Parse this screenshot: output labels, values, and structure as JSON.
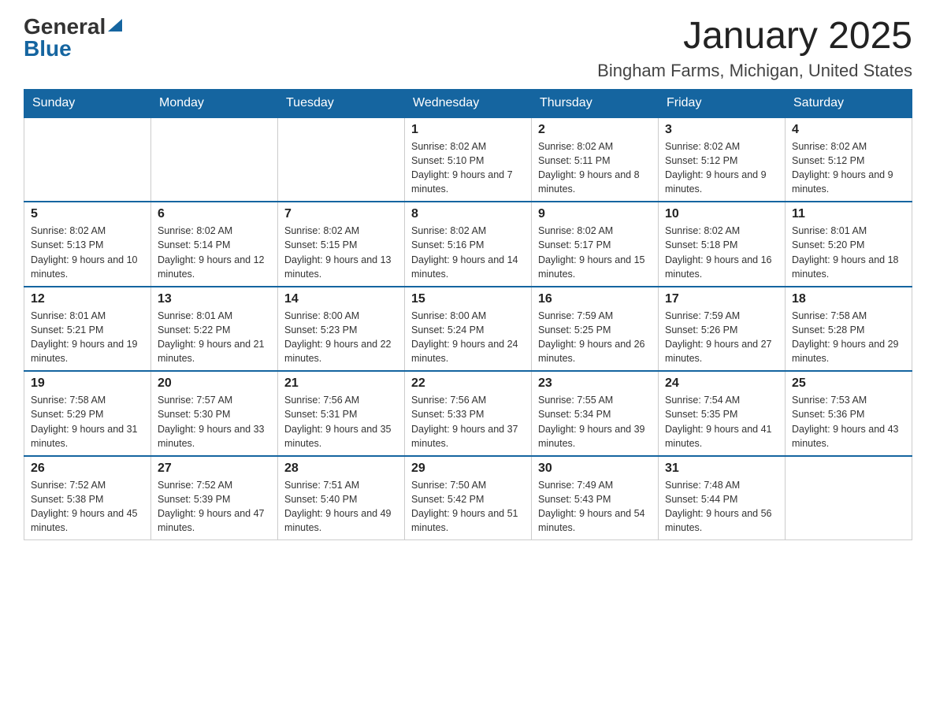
{
  "header": {
    "logo": {
      "general": "General",
      "blue": "Blue"
    },
    "title": "January 2025",
    "location": "Bingham Farms, Michigan, United States"
  },
  "days_of_week": [
    "Sunday",
    "Monday",
    "Tuesday",
    "Wednesday",
    "Thursday",
    "Friday",
    "Saturday"
  ],
  "weeks": [
    [
      {
        "day": "",
        "info": ""
      },
      {
        "day": "",
        "info": ""
      },
      {
        "day": "",
        "info": ""
      },
      {
        "day": "1",
        "info": "Sunrise: 8:02 AM\nSunset: 5:10 PM\nDaylight: 9 hours and 7 minutes."
      },
      {
        "day": "2",
        "info": "Sunrise: 8:02 AM\nSunset: 5:11 PM\nDaylight: 9 hours and 8 minutes."
      },
      {
        "day": "3",
        "info": "Sunrise: 8:02 AM\nSunset: 5:12 PM\nDaylight: 9 hours and 9 minutes."
      },
      {
        "day": "4",
        "info": "Sunrise: 8:02 AM\nSunset: 5:12 PM\nDaylight: 9 hours and 9 minutes."
      }
    ],
    [
      {
        "day": "5",
        "info": "Sunrise: 8:02 AM\nSunset: 5:13 PM\nDaylight: 9 hours and 10 minutes."
      },
      {
        "day": "6",
        "info": "Sunrise: 8:02 AM\nSunset: 5:14 PM\nDaylight: 9 hours and 12 minutes."
      },
      {
        "day": "7",
        "info": "Sunrise: 8:02 AM\nSunset: 5:15 PM\nDaylight: 9 hours and 13 minutes."
      },
      {
        "day": "8",
        "info": "Sunrise: 8:02 AM\nSunset: 5:16 PM\nDaylight: 9 hours and 14 minutes."
      },
      {
        "day": "9",
        "info": "Sunrise: 8:02 AM\nSunset: 5:17 PM\nDaylight: 9 hours and 15 minutes."
      },
      {
        "day": "10",
        "info": "Sunrise: 8:02 AM\nSunset: 5:18 PM\nDaylight: 9 hours and 16 minutes."
      },
      {
        "day": "11",
        "info": "Sunrise: 8:01 AM\nSunset: 5:20 PM\nDaylight: 9 hours and 18 minutes."
      }
    ],
    [
      {
        "day": "12",
        "info": "Sunrise: 8:01 AM\nSunset: 5:21 PM\nDaylight: 9 hours and 19 minutes."
      },
      {
        "day": "13",
        "info": "Sunrise: 8:01 AM\nSunset: 5:22 PM\nDaylight: 9 hours and 21 minutes."
      },
      {
        "day": "14",
        "info": "Sunrise: 8:00 AM\nSunset: 5:23 PM\nDaylight: 9 hours and 22 minutes."
      },
      {
        "day": "15",
        "info": "Sunrise: 8:00 AM\nSunset: 5:24 PM\nDaylight: 9 hours and 24 minutes."
      },
      {
        "day": "16",
        "info": "Sunrise: 7:59 AM\nSunset: 5:25 PM\nDaylight: 9 hours and 26 minutes."
      },
      {
        "day": "17",
        "info": "Sunrise: 7:59 AM\nSunset: 5:26 PM\nDaylight: 9 hours and 27 minutes."
      },
      {
        "day": "18",
        "info": "Sunrise: 7:58 AM\nSunset: 5:28 PM\nDaylight: 9 hours and 29 minutes."
      }
    ],
    [
      {
        "day": "19",
        "info": "Sunrise: 7:58 AM\nSunset: 5:29 PM\nDaylight: 9 hours and 31 minutes."
      },
      {
        "day": "20",
        "info": "Sunrise: 7:57 AM\nSunset: 5:30 PM\nDaylight: 9 hours and 33 minutes."
      },
      {
        "day": "21",
        "info": "Sunrise: 7:56 AM\nSunset: 5:31 PM\nDaylight: 9 hours and 35 minutes."
      },
      {
        "day": "22",
        "info": "Sunrise: 7:56 AM\nSunset: 5:33 PM\nDaylight: 9 hours and 37 minutes."
      },
      {
        "day": "23",
        "info": "Sunrise: 7:55 AM\nSunset: 5:34 PM\nDaylight: 9 hours and 39 minutes."
      },
      {
        "day": "24",
        "info": "Sunrise: 7:54 AM\nSunset: 5:35 PM\nDaylight: 9 hours and 41 minutes."
      },
      {
        "day": "25",
        "info": "Sunrise: 7:53 AM\nSunset: 5:36 PM\nDaylight: 9 hours and 43 minutes."
      }
    ],
    [
      {
        "day": "26",
        "info": "Sunrise: 7:52 AM\nSunset: 5:38 PM\nDaylight: 9 hours and 45 minutes."
      },
      {
        "day": "27",
        "info": "Sunrise: 7:52 AM\nSunset: 5:39 PM\nDaylight: 9 hours and 47 minutes."
      },
      {
        "day": "28",
        "info": "Sunrise: 7:51 AM\nSunset: 5:40 PM\nDaylight: 9 hours and 49 minutes."
      },
      {
        "day": "29",
        "info": "Sunrise: 7:50 AM\nSunset: 5:42 PM\nDaylight: 9 hours and 51 minutes."
      },
      {
        "day": "30",
        "info": "Sunrise: 7:49 AM\nSunset: 5:43 PM\nDaylight: 9 hours and 54 minutes."
      },
      {
        "day": "31",
        "info": "Sunrise: 7:48 AM\nSunset: 5:44 PM\nDaylight: 9 hours and 56 minutes."
      },
      {
        "day": "",
        "info": ""
      }
    ]
  ]
}
